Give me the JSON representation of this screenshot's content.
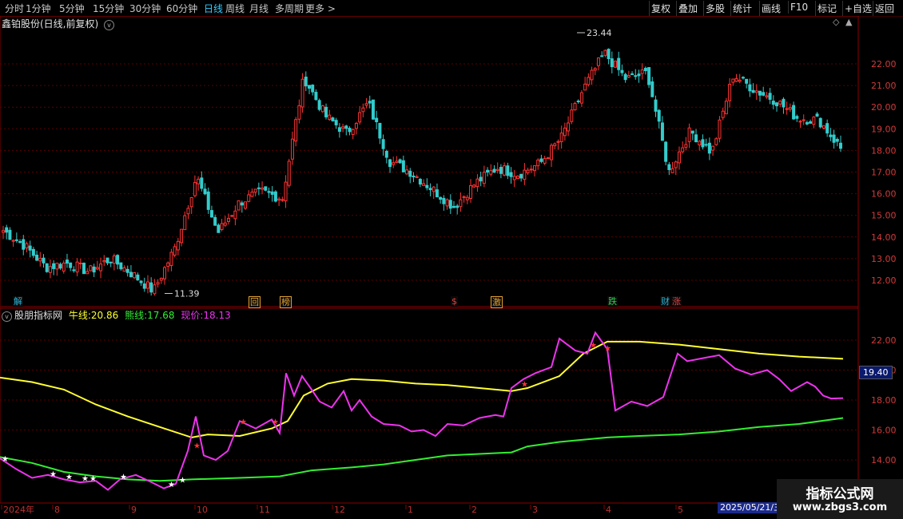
{
  "toolbar": {
    "periods": [
      "分时",
      "1分钟",
      "5分钟",
      "15分钟",
      "30分钟",
      "60分钟",
      "日线",
      "周线",
      "月线",
      "多周期",
      "更多 >"
    ],
    "active_period": "日线",
    "actions": [
      "复权",
      "叠加",
      "多股",
      "统计",
      "画线",
      "F10",
      "标记",
      "+自选",
      "返回"
    ]
  },
  "main": {
    "title": "鑫铂股份(日线,前复权)",
    "high_label": "23.44",
    "low_label": "11.39",
    "events": [
      {
        "text": "解",
        "color": "#2ab3d6"
      },
      {
        "text": "回",
        "color": "#e0a030"
      },
      {
        "text": "榜",
        "color": "#e0a030"
      },
      {
        "text": "$",
        "color": "#e04040"
      },
      {
        "text": "激",
        "color": "#e0a030"
      },
      {
        "text": "跌",
        "color": "#30d050"
      },
      {
        "text": "财",
        "color": "#2ab3d6"
      },
      {
        "text": "涨",
        "color": "#e04040"
      }
    ]
  },
  "indicator": {
    "name": "股朋指标网",
    "bull_label": "牛线:",
    "bull_value": "20.86",
    "bear_label": "熊线:",
    "bear_value": "17.68",
    "price_label": "现价:",
    "price_value": "18.13",
    "current_tag": "19.40"
  },
  "x_axis": {
    "labels": [
      "2024年",
      "8",
      "9",
      "10",
      "11",
      "12",
      "1",
      "2",
      "3",
      "4",
      "5"
    ],
    "cursor_date": "2025/05/21/三"
  },
  "watermark": {
    "line1": "指标公式网",
    "line2": "www.zbgs3.com"
  },
  "chart_data": [
    {
      "type": "candlestick",
      "title": "鑫铂股份(日线,前复权)",
      "y_ticks": [
        12.0,
        13.0,
        14.0,
        15.0,
        16.0,
        17.0,
        18.0,
        19.0,
        20.0,
        21.0,
        22.0
      ],
      "ylim": [
        11.2,
        23.6
      ],
      "x_categories": [
        "2024年",
        "8",
        "9",
        "10",
        "11",
        "12",
        "1",
        "2",
        "3",
        "4",
        "5"
      ],
      "approx_close_path": [
        [
          "2024-07",
          14.3
        ],
        [
          "2024-07",
          13.6
        ],
        [
          "2024-08",
          12.6
        ],
        [
          "2024-08",
          12.8
        ],
        [
          "2024-08",
          12.4
        ],
        [
          "2024-09",
          13.0
        ],
        [
          "2024-09",
          12.3
        ],
        [
          "2024-09",
          11.5
        ],
        [
          "2024-09",
          13.5
        ],
        [
          "2024-10",
          16.8
        ],
        [
          "2024-10",
          14.2
        ],
        [
          "2024-10",
          15.6
        ],
        [
          "2024-10",
          16.1
        ],
        [
          "2024-11",
          15.8
        ],
        [
          "2024-11",
          21.4
        ],
        [
          "2024-11",
          19.6
        ],
        [
          "2024-11",
          18.8
        ],
        [
          "2024-12",
          20.2
        ],
        [
          "2024-12",
          17.5
        ],
        [
          "2024-12",
          17.0
        ],
        [
          "2025-01",
          16.2
        ],
        [
          "2025-01",
          15.4
        ],
        [
          "2025-01",
          16.5
        ],
        [
          "2025-02",
          17.2
        ],
        [
          "2025-02",
          16.9
        ],
        [
          "2025-02",
          17.4
        ],
        [
          "2025-03",
          18.6
        ],
        [
          "2025-03",
          20.8
        ],
        [
          "2025-03",
          22.5
        ],
        [
          "2025-03",
          21.3
        ],
        [
          "2025-04",
          21.6
        ],
        [
          "2025-04",
          17.0
        ],
        [
          "2025-04",
          18.9
        ],
        [
          "2025-04",
          17.9
        ],
        [
          "2025-05",
          21.5
        ],
        [
          "2025-05",
          20.8
        ],
        [
          "2025-05",
          20.3
        ],
        [
          "2025-05",
          19.5
        ],
        [
          "2025-06",
          19.4
        ],
        [
          "2025-06",
          18.1
        ]
      ],
      "high": 23.44,
      "low": 11.39
    },
    {
      "type": "line",
      "title": "股朋指标网",
      "y_ticks": [
        14.0,
        16.0,
        18.0,
        20.0,
        22.0
      ],
      "ylim": [
        12.8,
        23.3
      ],
      "series": [
        {
          "name": "牛线",
          "color": "#ffff33",
          "values": [
            [
              0,
              19.5
            ],
            [
              40,
              19.2
            ],
            [
              80,
              18.7
            ],
            [
              120,
              17.7
            ],
            [
              160,
              16.9
            ],
            [
              200,
              16.2
            ],
            [
              240,
              15.5
            ],
            [
              260,
              15.7
            ],
            [
              300,
              15.6
            ],
            [
              340,
              16.1
            ],
            [
              360,
              16.6
            ],
            [
              380,
              18.3
            ],
            [
              410,
              19.1
            ],
            [
              440,
              19.4
            ],
            [
              480,
              19.3
            ],
            [
              520,
              19.1
            ],
            [
              560,
              19.0
            ],
            [
              600,
              18.8
            ],
            [
              640,
              18.6
            ],
            [
              660,
              18.8
            ],
            [
              700,
              19.6
            ],
            [
              730,
              21.1
            ],
            [
              760,
              21.9
            ],
            [
              800,
              21.9
            ],
            [
              850,
              21.7
            ],
            [
              900,
              21.4
            ],
            [
              950,
              21.1
            ],
            [
              1000,
              20.9
            ],
            [
              1055,
              20.75
            ]
          ]
        },
        {
          "name": "熊线",
          "color": "#33ee33",
          "values": [
            [
              0,
              14.2
            ],
            [
              40,
              13.8
            ],
            [
              80,
              13.2
            ],
            [
              120,
              12.9
            ],
            [
              160,
              12.7
            ],
            [
              200,
              12.6
            ],
            [
              240,
              12.7
            ],
            [
              300,
              12.8
            ],
            [
              350,
              12.9
            ],
            [
              390,
              13.3
            ],
            [
              440,
              13.5
            ],
            [
              480,
              13.7
            ],
            [
              520,
              14.0
            ],
            [
              560,
              14.3
            ],
            [
              600,
              14.4
            ],
            [
              640,
              14.5
            ],
            [
              660,
              14.9
            ],
            [
              700,
              15.2
            ],
            [
              760,
              15.5
            ],
            [
              800,
              15.6
            ],
            [
              850,
              15.7
            ],
            [
              900,
              15.9
            ],
            [
              950,
              16.2
            ],
            [
              1000,
              16.4
            ],
            [
              1055,
              16.8
            ]
          ]
        },
        {
          "name": "现价",
          "color": "#ee33ee",
          "values": [
            [
              0,
              14.1
            ],
            [
              20,
              13.4
            ],
            [
              40,
              12.8
            ],
            [
              60,
              13.0
            ],
            [
              80,
              12.7
            ],
            [
              100,
              12.5
            ],
            [
              120,
              12.6
            ],
            [
              135,
              12.0
            ],
            [
              150,
              12.7
            ],
            [
              170,
              13.0
            ],
            [
              190,
              12.5
            ],
            [
              205,
              12.1
            ],
            [
              220,
              12.4
            ],
            [
              235,
              14.6
            ],
            [
              245,
              16.9
            ],
            [
              255,
              14.3
            ],
            [
              270,
              14.0
            ],
            [
              285,
              14.6
            ],
            [
              300,
              16.6
            ],
            [
              320,
              16.1
            ],
            [
              340,
              16.7
            ],
            [
              350,
              15.8
            ],
            [
              358,
              19.8
            ],
            [
              368,
              18.3
            ],
            [
              378,
              19.6
            ],
            [
              390,
              18.7
            ],
            [
              400,
              17.9
            ],
            [
              415,
              17.5
            ],
            [
              430,
              18.6
            ],
            [
              440,
              17.3
            ],
            [
              450,
              18.0
            ],
            [
              465,
              16.9
            ],
            [
              480,
              16.4
            ],
            [
              500,
              16.3
            ],
            [
              515,
              15.9
            ],
            [
              530,
              16.0
            ],
            [
              545,
              15.6
            ],
            [
              560,
              16.4
            ],
            [
              580,
              16.3
            ],
            [
              600,
              16.8
            ],
            [
              620,
              17.0
            ],
            [
              630,
              16.9
            ],
            [
              640,
              18.8
            ],
            [
              655,
              19.4
            ],
            [
              670,
              19.8
            ],
            [
              690,
              20.2
            ],
            [
              700,
              22.1
            ],
            [
              720,
              21.3
            ],
            [
              735,
              21.1
            ],
            [
              745,
              22.5
            ],
            [
              760,
              21.4
            ],
            [
              770,
              17.3
            ],
            [
              790,
              17.9
            ],
            [
              810,
              17.6
            ],
            [
              830,
              18.2
            ],
            [
              848,
              21.1
            ],
            [
              860,
              20.6
            ],
            [
              880,
              20.8
            ],
            [
              900,
              21.0
            ],
            [
              920,
              20.1
            ],
            [
              940,
              19.7
            ],
            [
              960,
              20.0
            ],
            [
              975,
              19.4
            ],
            [
              990,
              18.6
            ],
            [
              1010,
              19.2
            ],
            [
              1020,
              18.9
            ],
            [
              1030,
              18.3
            ],
            [
              1040,
              18.1
            ],
            [
              1055,
              18.13
            ]
          ]
        }
      ]
    }
  ]
}
